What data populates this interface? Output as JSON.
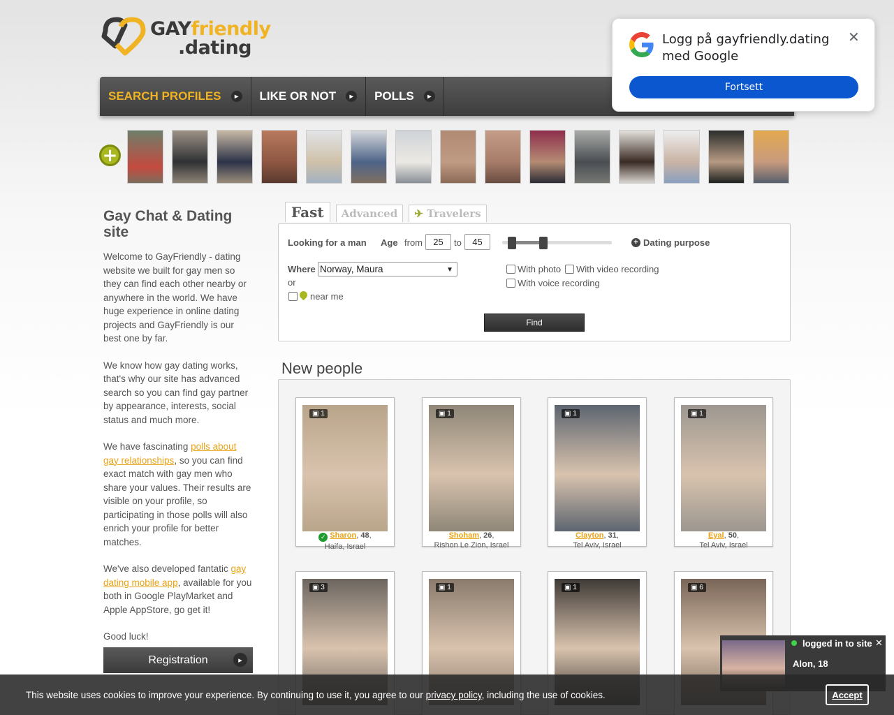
{
  "logo": {
    "gay": "GAY",
    "friendly": "friendly",
    "domain": ".dating",
    "colors": {
      "dark": "#3a3a3a",
      "accent": "#f0b323"
    }
  },
  "nav": [
    {
      "label": "SEARCH PROFILES",
      "active": true
    },
    {
      "label": "LIKE OR NOT",
      "active": false
    },
    {
      "label": "POLLS",
      "active": false
    }
  ],
  "strip": {
    "add_icon": "plus-icon",
    "count": 15
  },
  "left": {
    "title": "Gay Chat & Dating site",
    "p1": "Welcome to GayFriendly - dating website we built for gay men so they can find each other nearby or anywhere in the world. We have huge experience in online dating projects and GayFriendly is our best one by far.",
    "p2": "We know how gay dating works, that's why our site has advanced search so you can find gay partner by appearance, interests, social status and much more.",
    "p3_before": "We have fascinating ",
    "p3_link": "polls about gay relationships",
    "p3_after": ", so you can find exact match with gay men who share your values. Their results are visible on your profile, so participating in those polls will also enrich your profile for better matches.",
    "p4_before": "We've also developed fantatic ",
    "p4_link": "gay dating mobile app",
    "p4_after": ", available for you both in Google PlayMarket and Apple AppStore, go get it!",
    "p5": "Good luck!",
    "register": "Registration"
  },
  "search": {
    "tabs": [
      {
        "label": "Fast",
        "active": true
      },
      {
        "label": "Advanced",
        "active": false
      },
      {
        "label": "Travelers",
        "active": false,
        "icon": "plane-icon"
      }
    ],
    "looking_for": "Looking for a man",
    "age_label": "Age",
    "from_label": "from",
    "age_from": "25",
    "to_label": "to",
    "age_to": "45",
    "dating_purpose": "Dating purpose",
    "where_label": "Where",
    "where_value": "Norway, Maura",
    "or_label": "or",
    "near_me": "near me",
    "with_photo": "With photo",
    "with_video": "With video recording",
    "with_voice": "With voice recording",
    "find": "Find"
  },
  "new_people": {
    "title": "New people",
    "cards": [
      {
        "photos": "1",
        "name": "Sharon",
        "age": "48",
        "location": "Haifa, Israel",
        "verified": true,
        "bg": "#b9a58a"
      },
      {
        "photos": "1",
        "name": "Shoham",
        "age": "26",
        "location": "Rishon Le Zion, Israel",
        "verified": false,
        "bg": "#8f8778"
      },
      {
        "photos": "1",
        "name": "Clayton",
        "age": "31",
        "location": "Tel Aviv, Israel",
        "verified": false,
        "bg": "#5d6570"
      },
      {
        "photos": "1",
        "name": "Eyal",
        "age": "50",
        "location": "Tel Aviv, Israel",
        "verified": false,
        "bg": "#9c9790"
      },
      {
        "photos": "3",
        "name": "",
        "age": "",
        "location": "",
        "verified": false,
        "bg": "#6c6660"
      },
      {
        "photos": "1",
        "name": "",
        "age": "",
        "location": "",
        "verified": false,
        "bg": "#8a7b6d"
      },
      {
        "photos": "1",
        "name": "",
        "age": "",
        "location": "",
        "verified": false,
        "bg": "#3f3a36"
      },
      {
        "photos": "6",
        "name": "",
        "age": "",
        "location": "",
        "verified": false,
        "bg": "#7a6658"
      }
    ]
  },
  "google": {
    "title": "Logg på gayfriendly.dating med Google",
    "button": "Fortsett",
    "button_color": "#0b57d0"
  },
  "notify": {
    "label": "logged in to site",
    "name": "Alon, 18"
  },
  "cookie": {
    "text_before": "This website uses cookies to improve your experience. By continuing to use it, you agree to our ",
    "link": "privacy policy",
    "text_after": ", including the use of cookies.",
    "accept": "Accept"
  }
}
